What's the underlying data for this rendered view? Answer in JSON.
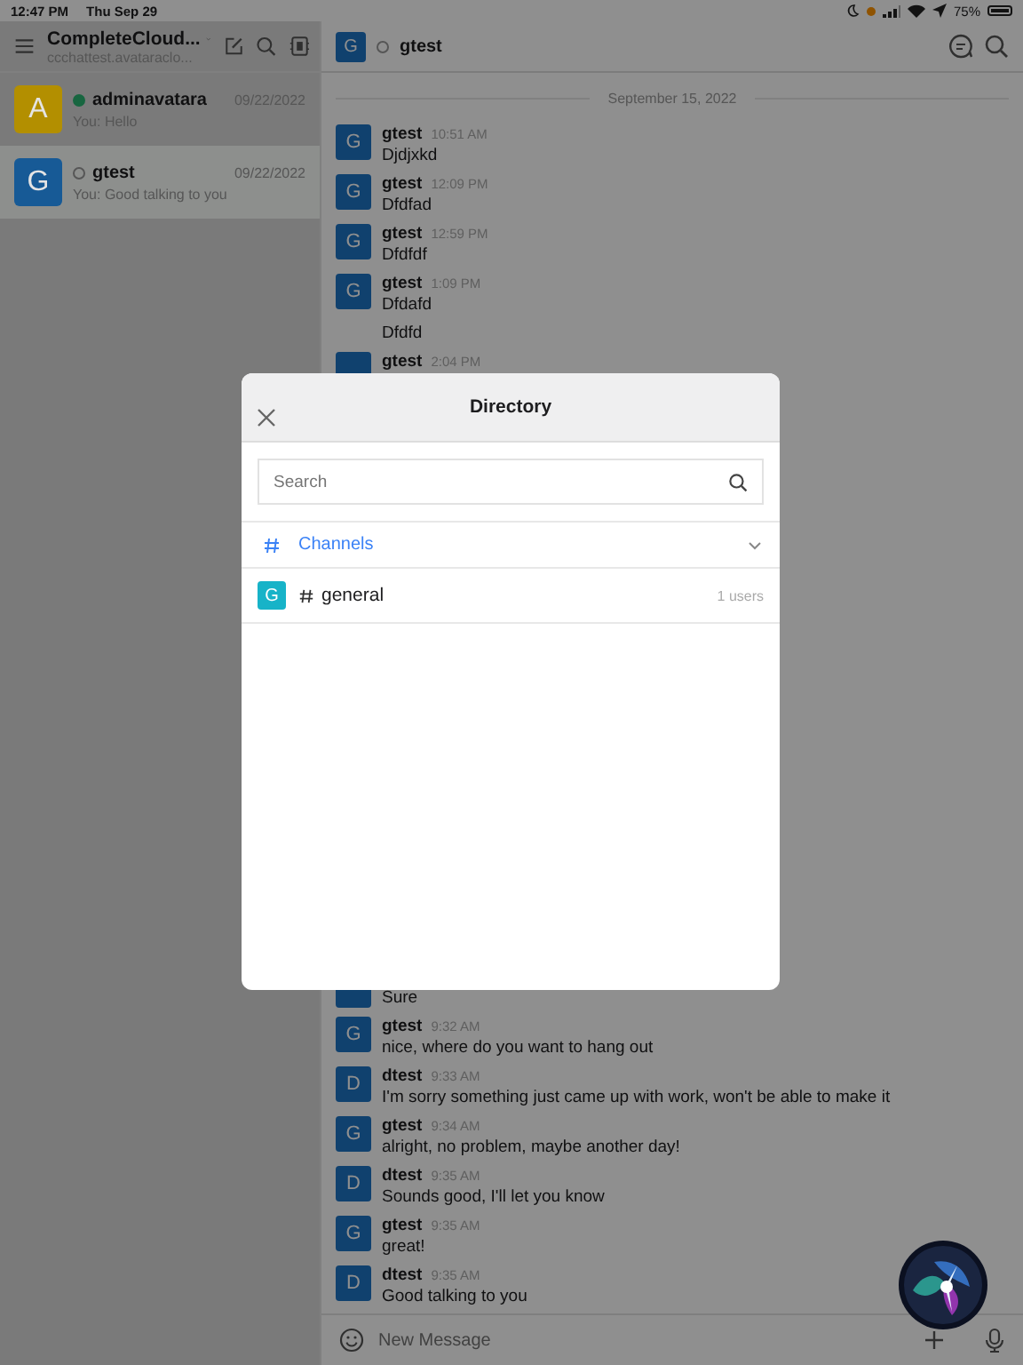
{
  "status_bar": {
    "time": "12:47 PM",
    "date": "Thu Sep 29",
    "battery": "75%"
  },
  "sidebar": {
    "workspace": "CompleteCloud...",
    "server": "ccchattest.avataraclo...",
    "conversations": [
      {
        "avatar": "A",
        "color": "#b38f00",
        "name": "adminavatara",
        "online": true,
        "date": "09/22/2022",
        "preview": "You: Hello",
        "selected": false
      },
      {
        "avatar": "G",
        "color": "#175a96",
        "name": "gtest",
        "online": false,
        "date": "09/22/2022",
        "preview": "You: Good talking to you",
        "selected": true
      }
    ]
  },
  "chat": {
    "header": {
      "avatar": "G",
      "name": "gtest",
      "online": false
    },
    "date_separator": "September 15, 2022",
    "messages_top": [
      {
        "kind": "message",
        "avatar": "G",
        "name": "gtest",
        "time": "10:51 AM",
        "text": "Djdjxkd"
      },
      {
        "kind": "message",
        "avatar": "G",
        "name": "gtest",
        "time": "12:09 PM",
        "text": "Dfdfad"
      },
      {
        "kind": "message",
        "avatar": "G",
        "name": "gtest",
        "time": "12:59 PM",
        "text": "Dfdfdf"
      },
      {
        "kind": "message",
        "avatar": "G",
        "name": "gtest",
        "time": "1:09 PM",
        "text": "Dfdafd"
      },
      {
        "kind": "continuation",
        "text": "Dfdfd"
      },
      {
        "kind": "message",
        "name": "gtest",
        "time": "2:04 PM"
      }
    ],
    "messages_bottom": [
      {
        "kind": "tail",
        "text": "Sure"
      },
      {
        "kind": "message",
        "avatar": "G",
        "name": "gtest",
        "time": "9:32 AM",
        "text": "nice, where do you want to hang out"
      },
      {
        "kind": "message",
        "avatar": "D",
        "name": "dtest",
        "time": "9:33 AM",
        "text": "I'm sorry something just came up with work, won't be able to make it"
      },
      {
        "kind": "message",
        "avatar": "G",
        "name": "gtest",
        "time": "9:34 AM",
        "text": "alright, no problem, maybe another day!"
      },
      {
        "kind": "message",
        "avatar": "D",
        "name": "dtest",
        "time": "9:35 AM",
        "text": "Sounds good, I'll let you know"
      },
      {
        "kind": "message",
        "avatar": "G",
        "name": "gtest",
        "time": "9:35 AM",
        "text": "great!"
      },
      {
        "kind": "message",
        "avatar": "D",
        "name": "dtest",
        "time": "9:35 AM",
        "text": "Good talking to you"
      }
    ],
    "composer": {
      "placeholder": "New Message"
    }
  },
  "directory": {
    "title": "Directory",
    "search": {
      "placeholder": "Search"
    },
    "section": {
      "label": "Channels",
      "expanded": true
    },
    "channels": [
      {
        "avatar": "G",
        "name": "general",
        "members": "1 users"
      }
    ]
  }
}
